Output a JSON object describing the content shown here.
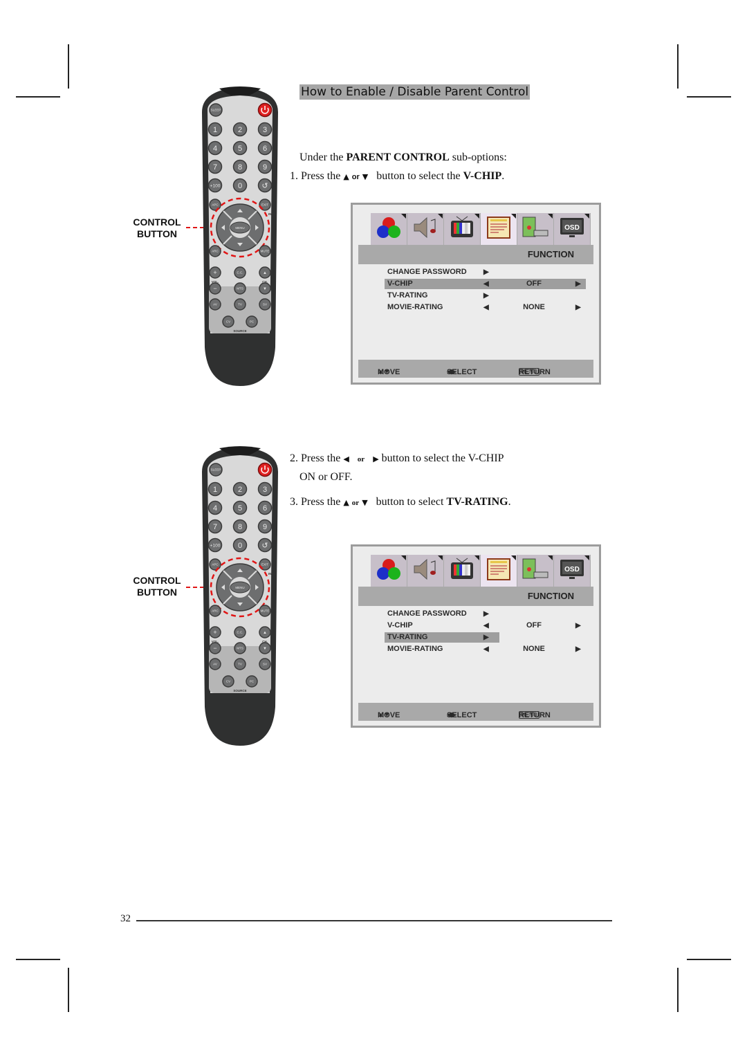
{
  "page": {
    "title": "How to Enable / Disable Parent Control",
    "page_number": "32"
  },
  "step_intro": {
    "prefix": "Under the ",
    "bold": "PARENT CONTROL",
    "suffix": " sub-options:"
  },
  "step1": {
    "prefix": "1. Press the ",
    "up_icon": "▲",
    "or": "or",
    "down_icon": "▼",
    "middle": " button to select the ",
    "bold": "V-CHIP",
    "suffix": "."
  },
  "step2": {
    "prefix": "2. Press the ",
    "left_icon": "◀",
    "or": "or",
    "right_icon": "▶",
    "middle": " button to select the V-CHIP",
    "line2": "ON or OFF."
  },
  "step3": {
    "prefix": "3. Press the ",
    "up_icon": "▲",
    "or": "or",
    "down_icon": "▼",
    "middle": " button to select ",
    "bold": "TV-RATING",
    "suffix": "."
  },
  "remote": {
    "callout_line1": "CONTROL",
    "callout_line2": "BUTTON",
    "buttons": {
      "sleep": "SLEEP",
      "digits": [
        "1",
        "2",
        "3",
        "4",
        "5",
        "6",
        "7",
        "8",
        "9"
      ],
      "plus100": "+100",
      "zero": "0",
      "recall": "↺",
      "apc": "APC",
      "exit": "EXIT",
      "info": "INFO",
      "menu": "MENU",
      "arc": "ARC",
      "mute": "MUTE",
      "vol_up": "+",
      "cc": "C.C.",
      "ch_up": "▲",
      "vol": "VOL.",
      "ch": "CH.",
      "vol_down": "−",
      "mts": "MTS",
      "ch_down": "▼",
      "av": "AV",
      "tv": "TV",
      "sv": "SV",
      "cv": "CV",
      "pc": "PC",
      "source": "SOURCE"
    },
    "colors": {
      "power": "#e02020",
      "callout": "#e01515"
    }
  },
  "osd_screens": [
    {
      "tabs": [
        "picture-icon",
        "sound-icon",
        "tv-icon",
        "function-icon",
        "pc-icon",
        "osd-icon"
      ],
      "selected_tab": 3,
      "osd_label": "OSD",
      "section_title": "FUNCTION",
      "rows": [
        {
          "label": "CHANGE PASSWORD",
          "left": "",
          "value": "",
          "right": "▶"
        },
        {
          "label": "V-CHIP",
          "left": "◀",
          "value": "OFF",
          "right": "▶"
        },
        {
          "label": "TV-RATING",
          "left": "",
          "value": "",
          "right": "▶"
        },
        {
          "label": "MOVIE-RATING",
          "left": "◀",
          "value": "NONE",
          "right": "▶"
        }
      ],
      "highlighted_row": 1,
      "footer": {
        "move": "MOVE",
        "select": "SELECT",
        "menu_key": "MENU",
        "return": "RETURN"
      }
    },
    {
      "tabs": [
        "picture-icon",
        "sound-icon",
        "tv-icon",
        "function-icon",
        "pc-icon",
        "osd-icon"
      ],
      "selected_tab": 3,
      "osd_label": "OSD",
      "section_title": "FUNCTION",
      "rows": [
        {
          "label": "CHANGE PASSWORD",
          "left": "",
          "value": "",
          "right": "▶"
        },
        {
          "label": "V-CHIP",
          "left": "◀",
          "value": "OFF",
          "right": "▶"
        },
        {
          "label": "TV-RATING",
          "left": "",
          "value": "",
          "right": "▶"
        },
        {
          "label": "MOVIE-RATING",
          "left": "◀",
          "value": "NONE",
          "right": "▶"
        }
      ],
      "highlighted_row": 2,
      "footer": {
        "move": "MOVE",
        "select": "SELECT",
        "menu_key": "MENU",
        "return": "RETURN"
      }
    }
  ]
}
